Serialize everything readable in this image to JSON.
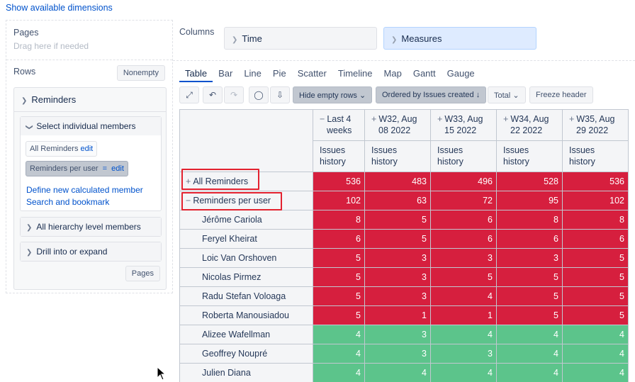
{
  "top_link": "Show available dimensions",
  "pages": {
    "title": "Pages",
    "hint": "Drag here if needed"
  },
  "rows": {
    "title": "Rows",
    "nonempty_label": "Nonempty",
    "dimension": {
      "name": "Reminders",
      "select_members_label": "Select individual members",
      "chip_all": "All Reminders",
      "chip_per_user": "Reminders per user",
      "chip_eq": "=",
      "edit_label": "edit",
      "define_link": "Define new calculated member",
      "search_link": "Search and bookmark",
      "all_hierarchy_label": "All hierarchy level members",
      "drill_label": "Drill into or expand",
      "pages_button": "Pages"
    }
  },
  "columns": {
    "title": "Columns",
    "time_label": "Time",
    "measures_label": "Measures"
  },
  "tabs": [
    "Table",
    "Bar",
    "Line",
    "Pie",
    "Scatter",
    "Timeline",
    "Map",
    "Gantt",
    "Gauge"
  ],
  "toolbar": {
    "hide_empty_rows": "Hide empty rows",
    "ordered_by": "Ordered by Issues created",
    "total": "Total",
    "freeze_header": "Freeze header"
  },
  "table": {
    "columns": [
      {
        "l1": "Last 4",
        "l2": "weeks",
        "sign": "−"
      },
      {
        "l1": "W32, Aug",
        "l2": "08 2022",
        "sign": "+"
      },
      {
        "l1": "W33, Aug",
        "l2": "15 2022",
        "sign": "+"
      },
      {
        "l1": "W34, Aug",
        "l2": "22 2022",
        "sign": "+"
      },
      {
        "l1": "W35, Aug",
        "l2": "29 2022",
        "sign": "+"
      }
    ],
    "measure_l1": "Issues",
    "measure_l2": "history",
    "rows": [
      {
        "label": "All Reminders",
        "sign": "+",
        "values": [
          "536",
          "483",
          "496",
          "528",
          "536"
        ]
      },
      {
        "label": "Reminders per user",
        "sign": "−",
        "values": [
          "102",
          "63",
          "72",
          "95",
          "102"
        ]
      },
      {
        "label": "Jérôme Cariola",
        "values": [
          "8",
          "5",
          "6",
          "8",
          "8"
        ]
      },
      {
        "label": "Feryel Kheirat",
        "values": [
          "6",
          "5",
          "6",
          "6",
          "6"
        ]
      },
      {
        "label": "Loic Van Orshoven",
        "values": [
          "5",
          "3",
          "3",
          "3",
          "5"
        ]
      },
      {
        "label": "Nicolas Pirmez",
        "values": [
          "5",
          "3",
          "5",
          "5",
          "5"
        ]
      },
      {
        "label": "Radu Stefan Voloaga",
        "values": [
          "5",
          "3",
          "4",
          "5",
          "5"
        ]
      },
      {
        "label": "Roberta Manousiadou",
        "values": [
          "5",
          "1",
          "1",
          "5",
          "5"
        ]
      },
      {
        "label": "Alizee Wafellman",
        "values": [
          "4",
          "3",
          "4",
          "4",
          "4"
        ]
      },
      {
        "label": "Geoffrey Noupré",
        "values": [
          "4",
          "3",
          "3",
          "4",
          "4"
        ]
      },
      {
        "label": "Julien Diana",
        "values": [
          "4",
          "4",
          "4",
          "4",
          "4"
        ]
      }
    ]
  },
  "colors": {
    "high": "#d61f3e",
    "low": "#5cc48b",
    "accent": "#0052cc"
  }
}
